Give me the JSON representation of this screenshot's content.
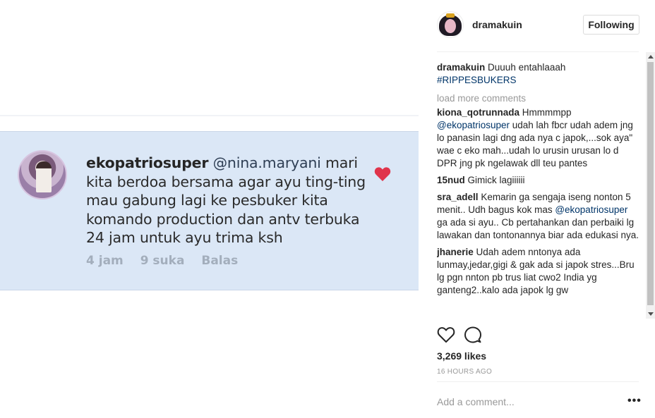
{
  "media": {
    "comment_user": "ekopatriosuper",
    "comment_mention": "@nina.maryani",
    "comment_text": "mari kita berdoa bersama agar ayu ting-ting mau gabung lagi ke pesbuker kita komando production dan antv terbuka 24 jam untuk ayu trima ksh",
    "meta_time": "4 jam",
    "meta_likes": "9 suka",
    "meta_reply": "Balas",
    "heart_color": "#e0344b"
  },
  "header": {
    "username": "dramakuin",
    "follow_label": "Following"
  },
  "caption": {
    "user": "dramakuin",
    "text": "Duuuh entahlaaah",
    "hashtag": "#RIPPESBUKERS"
  },
  "load_more": "load more comments",
  "comments": [
    {
      "user": "kiona_qotrunnada",
      "parts": [
        "Hmmmmpp ",
        "@ekopatriosuper",
        " udah lah fbcr udah adem jng lo panasin lagi dng ada nya c japok,...sok aya\" wae c eko mah...udah lo urusin urusan lo d DPR jng pk ngelawak dll teu pantes"
      ]
    },
    {
      "user": "15nud",
      "parts": [
        "Gimick lagiiiiii"
      ]
    },
    {
      "user": "sra_adell",
      "parts": [
        "Kemarin ga sengaja iseng nonton 5 menit.. Udh bagus kok mas ",
        "@ekopatriosuper",
        " ga ada si ayu.. Cb pertahankan dan perbaiki lg lawakan dan tontonannya biar ada edukasi nya."
      ]
    },
    {
      "user": "jhanerie",
      "parts": [
        "Udah adem nntonya ada lunmay,jedar,gigi & gak ada si japok stres...Bru lg pgn nnton pb trus liat cwo2 India yg ganteng2..kalo ada japok lg gw"
      ]
    }
  ],
  "likes": "3,269 likes",
  "time": "16 HOURS AGO",
  "add_comment": {
    "placeholder": "Add a comment..."
  },
  "icons": [
    "heart-icon",
    "comment-icon",
    "more-options-icon"
  ],
  "colors": {
    "link": "#003569",
    "muted": "#999999",
    "media_bg": "#dbe7f6"
  }
}
